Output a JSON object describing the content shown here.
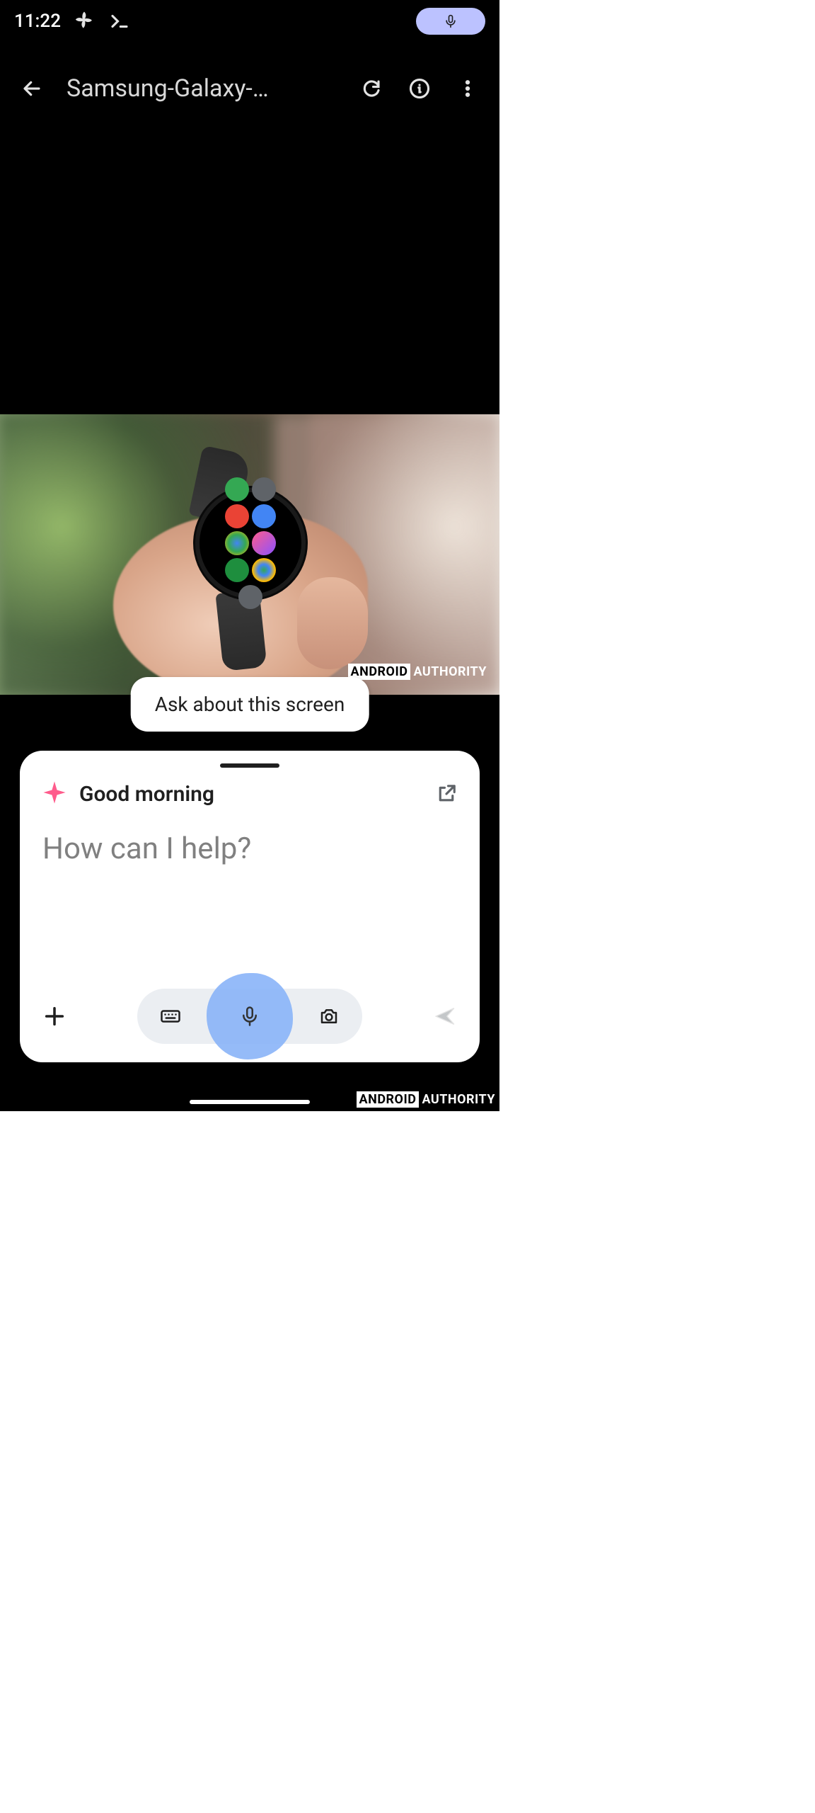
{
  "status": {
    "time": "11:22",
    "icons": [
      "pinwheel-icon",
      "terminal-icon"
    ],
    "right_pill_icon": "mic-icon"
  },
  "appbar": {
    "title": "Samsung-Galaxy-…",
    "actions": [
      "rotate-icon",
      "info-icon",
      "more-icon"
    ]
  },
  "photo": {
    "subject": "Samsung Galaxy Watch held in hand showing app grid",
    "watermark_boxed": "ANDROID",
    "watermark_rest": "AUTHORITY"
  },
  "suggestion_chip": "Ask about this screen",
  "assistant": {
    "greeting": "Good morning",
    "prompt": "How can I help?",
    "toolbar": {
      "plus": "Add",
      "keyboard_tooltip": "Keyboard",
      "voice_tooltip": "Voice input",
      "camera_tooltip": "Camera",
      "send": "Send"
    }
  },
  "outer_watermark": {
    "boxed": "ANDROID",
    "rest": "AUTHORITY"
  }
}
